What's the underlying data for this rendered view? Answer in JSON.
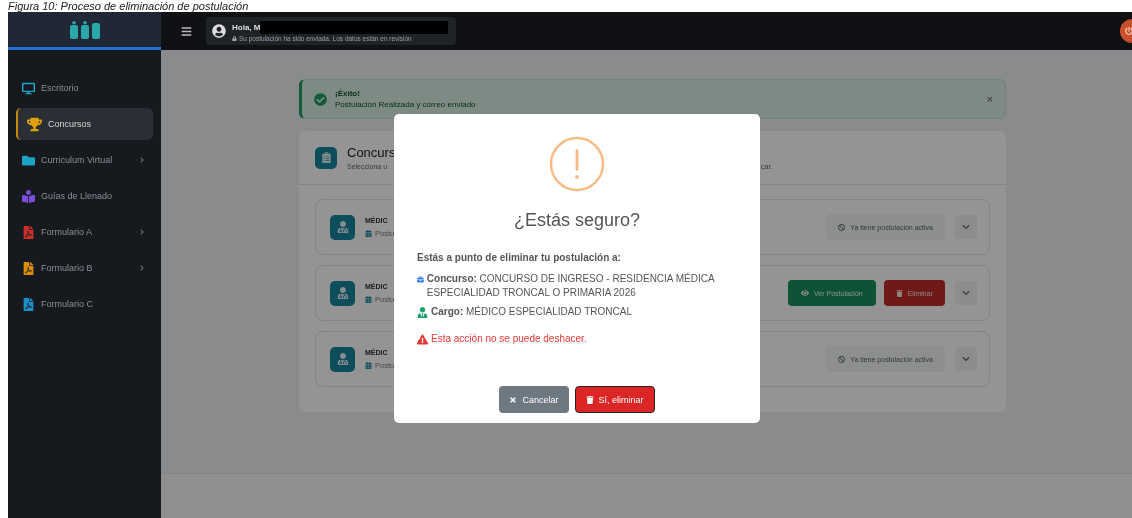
{
  "caption": "Figura 10: Proceso de eliminación de postulación",
  "header": {
    "greeting": "Hola, M",
    "status": "Su postulación ha sido enviada. Los datos están en revisión"
  },
  "sidebar": {
    "items": [
      {
        "label": "Escritorio",
        "kind": "desk",
        "color": "#1ba3c6",
        "selected": false,
        "expandable": false
      },
      {
        "label": "Concursos",
        "kind": "trophy",
        "color": "#e0a106",
        "selected": true,
        "expandable": false
      },
      {
        "label": "Curriculum Virtual",
        "kind": "folder",
        "color": "#1ba3c6",
        "selected": false,
        "expandable": true
      },
      {
        "label": "Guías de Llenado",
        "kind": "guide",
        "color": "#7a4fd6",
        "selected": false,
        "expandable": false
      },
      {
        "label": "Formulario A",
        "kind": "pdf",
        "color": "#c9302c",
        "selected": false,
        "expandable": true
      },
      {
        "label": "Formulario B",
        "kind": "pdf",
        "color": "#d98d0b",
        "selected": false,
        "expandable": true
      },
      {
        "label": "Formulario C",
        "kind": "pdf",
        "color": "#1b8fc6",
        "selected": false,
        "expandable": false
      }
    ]
  },
  "alert": {
    "title": "¡Éxito!",
    "message": "Postulación Realizada y correo enviado",
    "close": "×"
  },
  "card": {
    "title": "Concurs",
    "subtitle": "Selecciona u",
    "subtitle_end": "car.",
    "rows": [
      {
        "title": "MÉDIC",
        "meta": "Postu",
        "kind": "blocked",
        "note": "Ya tiene postulación activa"
      },
      {
        "title": "MÉDIC",
        "meta": "Postu",
        "kind": "applied",
        "view": "Ver Postulación",
        "delete": "Eliminar"
      },
      {
        "title": "MÉDIC",
        "meta": "Postu",
        "kind": "blocked",
        "note": "Ya tiene postulación activa"
      }
    ]
  },
  "modal": {
    "title": "¿Estás seguro?",
    "intro": "Estás a punto de eliminar tu postulación a:",
    "details": [
      {
        "kind": "contest",
        "text": "**Concurso:** CONCURSO DE INGRESO - RESIDENCIA MÉDICA ESPECIALIDAD TRONCAL O PRIMARIA 2026"
      },
      {
        "kind": "position",
        "text": "**Cargo:** MÉDICO ESPECIALIDAD TRONCAL"
      }
    ],
    "warning": "Esta acción no se puede deshacer.",
    "cancel": "Cancelar",
    "confirm": "Sí, eliminar"
  }
}
